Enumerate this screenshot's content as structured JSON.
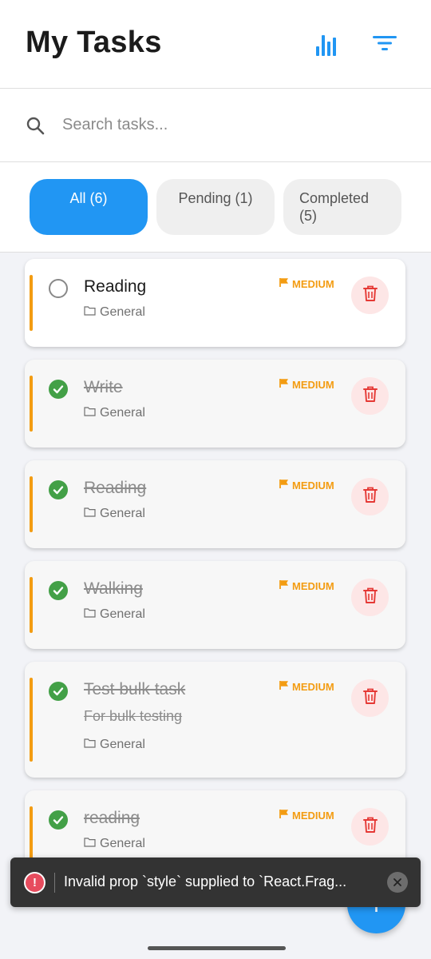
{
  "header": {
    "title": "My Tasks",
    "stats_icon": "bar-chart-icon",
    "filter_icon": "filter-icon"
  },
  "search": {
    "placeholder": "Search tasks...",
    "value": ""
  },
  "tabs": [
    {
      "label": "All (6)",
      "active": true
    },
    {
      "label": "Pending (1)",
      "active": false
    },
    {
      "label": "Completed (5)",
      "active": false
    }
  ],
  "tasks": [
    {
      "title": "Reading",
      "description": "",
      "category": "General",
      "priority": "MEDIUM",
      "completed": false
    },
    {
      "title": "Write",
      "description": "",
      "category": "General",
      "priority": "MEDIUM",
      "completed": true
    },
    {
      "title": "Reading",
      "description": "",
      "category": "General",
      "priority": "MEDIUM",
      "completed": true
    },
    {
      "title": "Walking",
      "description": "",
      "category": "General",
      "priority": "MEDIUM",
      "completed": true
    },
    {
      "title": "Test bulk task",
      "description": "For bulk testing",
      "category": "General",
      "priority": "MEDIUM",
      "completed": true
    },
    {
      "title": "reading",
      "description": "",
      "category": "General",
      "priority": "MEDIUM",
      "completed": true
    }
  ],
  "toast": {
    "message": "Invalid prop `style` supplied to `React.Frag..."
  },
  "fab": {
    "label": "+"
  },
  "colors": {
    "accent": "#2196f3",
    "priority_medium": "#f39c12",
    "complete": "#43a047",
    "delete": "#e53935"
  }
}
